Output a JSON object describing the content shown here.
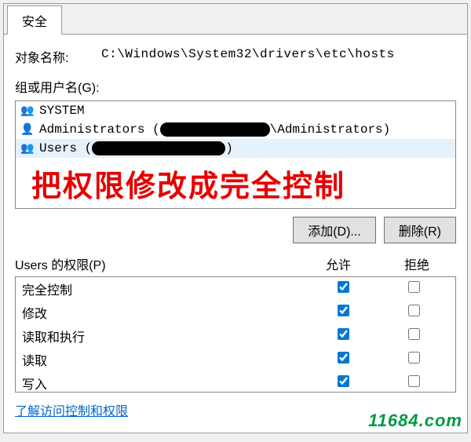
{
  "tab": {
    "security_label": "安全"
  },
  "object": {
    "label": "对象名称:",
    "path": "C:\\Windows\\System32\\drivers\\etc\\hosts"
  },
  "groups": {
    "label": "组或用户名(G):",
    "items": [
      {
        "icon": "users-icon",
        "text_prefix": "SYSTEM",
        "text_suffix": "",
        "redaction": ""
      },
      {
        "icon": "user-icon",
        "text_prefix": "Administrators (",
        "text_suffix": "\\Administrators)",
        "redaction": "r1"
      },
      {
        "icon": "users-icon",
        "text_prefix": "Users (",
        "text_suffix": ")",
        "redaction": "r2"
      }
    ],
    "annotation": "把权限修改成完全控制"
  },
  "buttons": {
    "add": "添加(D)...",
    "remove": "删除(R)"
  },
  "permissions": {
    "header_label": "Users 的权限(P)",
    "allow_label": "允许",
    "deny_label": "拒绝",
    "rows": [
      {
        "name": "完全控制",
        "allow": true,
        "deny": false
      },
      {
        "name": "修改",
        "allow": true,
        "deny": false
      },
      {
        "name": "读取和执行",
        "allow": true,
        "deny": false
      },
      {
        "name": "读取",
        "allow": true,
        "deny": false
      },
      {
        "name": "写入",
        "allow": true,
        "deny": false
      }
    ]
  },
  "footer": {
    "link": "了解访问控制和权限"
  },
  "watermark": "11684.com"
}
